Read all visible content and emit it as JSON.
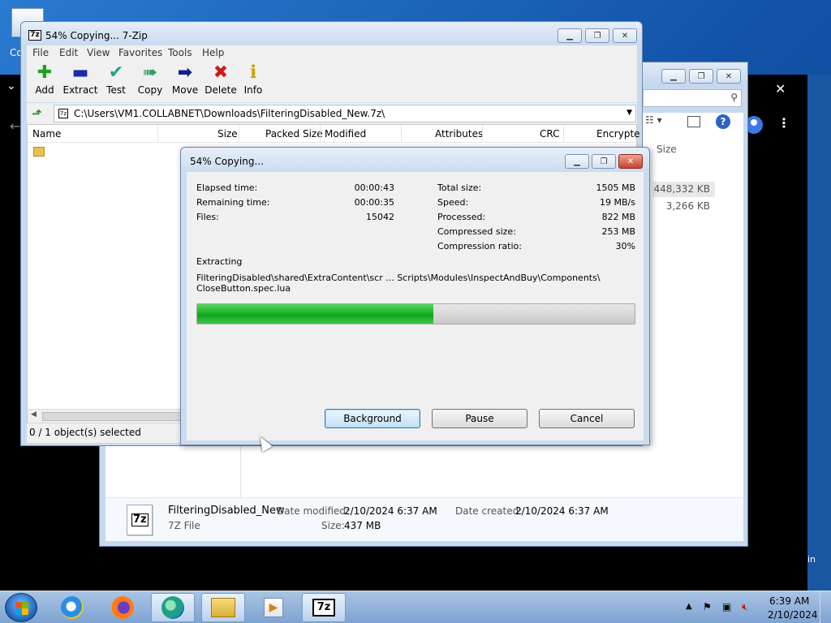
{
  "desktop": {
    "icon_label": "Co"
  },
  "browser": {
    "side_text": "in"
  },
  "explorer": {
    "column_size": "Size",
    "rows": [
      {
        "size": "448,332 KB"
      },
      {
        "size": "3,266 KB"
      }
    ],
    "details": {
      "icon_text": "7z",
      "name": "FilteringDisabled_New",
      "type": "7Z File",
      "date_modified_label": "Date modified:",
      "date_modified": "2/10/2024 6:37 AM",
      "date_created_label": "Date created:",
      "date_created": "2/10/2024 6:37 AM",
      "size_label": "Size:",
      "size": "437 MB"
    }
  },
  "sevenzip": {
    "title": "54% Copying... 7-Zip",
    "title_icon": "7z",
    "menu": [
      "File",
      "Edit",
      "View",
      "Favorites",
      "Tools",
      "Help"
    ],
    "toolbar": [
      {
        "label": "Add",
        "icon": "plus-icon",
        "glyph": "✚",
        "color": "#1f9d1f"
      },
      {
        "label": "Extract",
        "icon": "minus-icon",
        "glyph": "▬",
        "color": "#1a2aa8"
      },
      {
        "label": "Test",
        "icon": "check-icon",
        "glyph": "✔",
        "color": "#1aa58c"
      },
      {
        "label": "Copy",
        "icon": "double-arrow-icon",
        "glyph": "➠",
        "color": "#2f9e6b"
      },
      {
        "label": "Move",
        "icon": "arrow-right-icon",
        "glyph": "➡",
        "color": "#0f1f8a"
      },
      {
        "label": "Delete",
        "icon": "x-icon",
        "glyph": "✖",
        "color": "#d01a1a"
      },
      {
        "label": "Info",
        "icon": "info-icon",
        "glyph": "ℹ",
        "color": "#c8a200"
      }
    ],
    "path": "C:\\Users\\VM1.COLLABNET\\Downloads\\FilteringDisabled_New.7z\\",
    "columns": [
      "Name",
      "Size",
      "Packed Size",
      "Modified",
      "Attributes",
      "CRC",
      "Encrypte"
    ],
    "status": "0 / 1 object(s) selected"
  },
  "dialog": {
    "title": "54% Copying...",
    "progress_percent": 54,
    "left_stats": [
      {
        "label": "Elapsed time:",
        "value": "00:00:43"
      },
      {
        "label": "Remaining time:",
        "value": "00:00:35"
      },
      {
        "label": "Files:",
        "value": "15042"
      }
    ],
    "right_stats": [
      {
        "label": "Total size:",
        "value": "1505 MB"
      },
      {
        "label": "Speed:",
        "value": "19 MB/s"
      },
      {
        "label": "Processed:",
        "value": "822 MB"
      },
      {
        "label": "Compressed size:",
        "value": "253 MB"
      },
      {
        "label": "Compression ratio:",
        "value": "30%"
      }
    ],
    "operation": "Extracting",
    "file_line1": "FilteringDisabled\\shared\\ExtraContent\\scr ... Scripts\\Modules\\InspectAndBuy\\Components\\",
    "file_line2": "CloseButton.spec.lua",
    "buttons": {
      "background": "Background",
      "pause": "Pause",
      "cancel": "Cancel"
    }
  },
  "taskbar": {
    "apps": [
      "internet-explorer-icon",
      "firefox-icon",
      "edge-icon",
      "file-explorer-icon",
      "media-player-icon",
      "7zip-icon"
    ],
    "active_app_label": "7z",
    "time": "6:39 AM",
    "date": "2/10/2024"
  }
}
